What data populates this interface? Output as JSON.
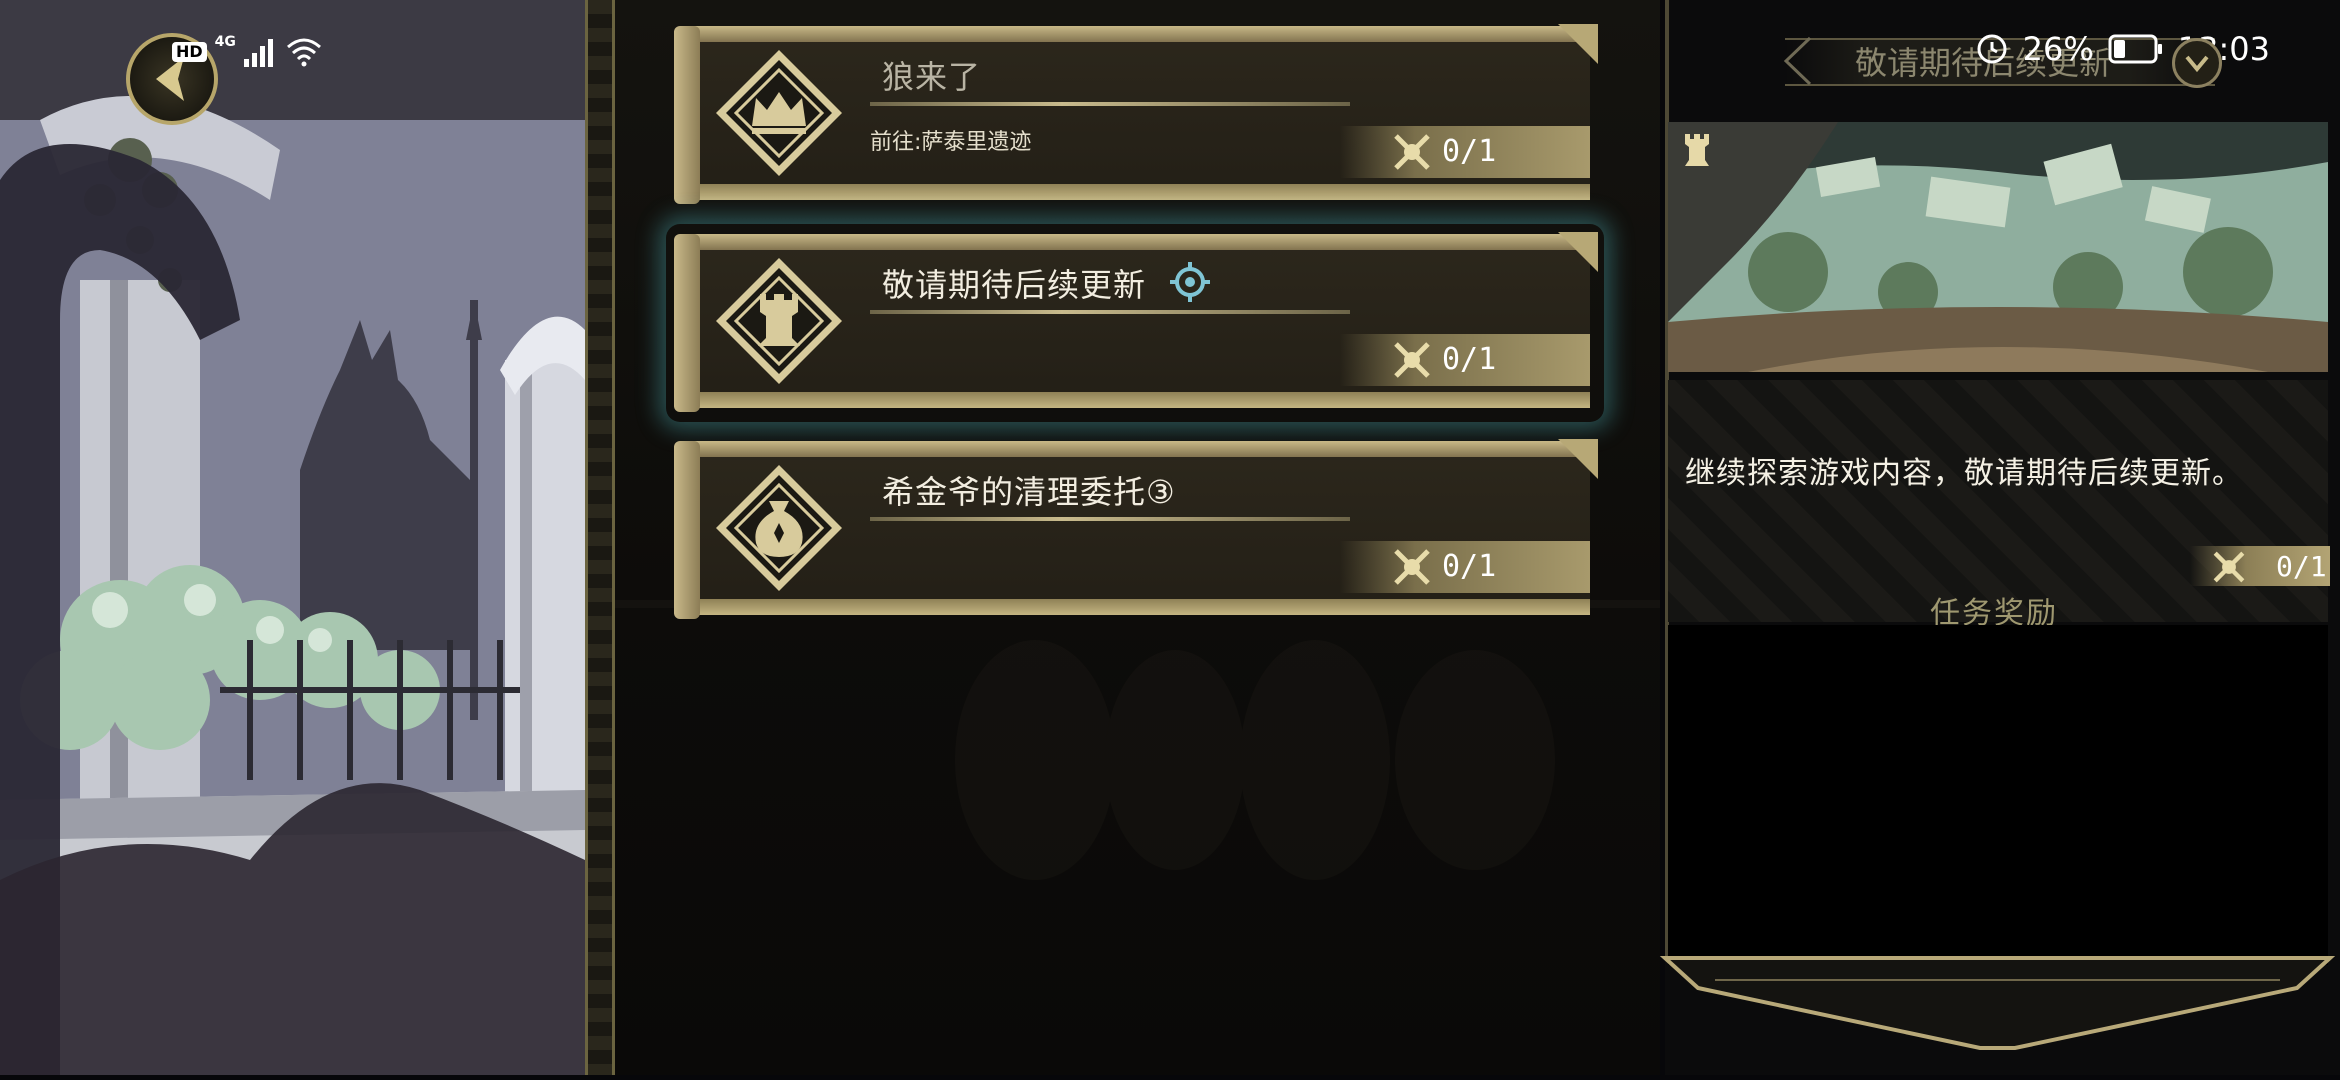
{
  "status_bar": {
    "network": "HD",
    "signal_type": "4G",
    "battery": "26%",
    "time": "13:03"
  },
  "quests": [
    {
      "title": "狼来了",
      "subtitle": "前往:萨泰里遗迹",
      "progress": "0/1",
      "icon": "crown-icon",
      "selected": false
    },
    {
      "title": "敬请期待后续更新",
      "subtitle": "",
      "progress": "0/1",
      "icon": "tower-icon",
      "selected": true
    },
    {
      "title": "希金爷的清理委托③",
      "subtitle": "",
      "progress": "0/1",
      "icon": "money-bag-icon",
      "selected": false
    }
  ],
  "detail": {
    "title": "敬请期待后续更新",
    "description": "继续探索游戏内容，敬请期待后续更新。",
    "progress": "0/1",
    "reward_label": "任务奖励"
  },
  "colors": {
    "gold": "#b7a66a",
    "selected_glow": "#5ac8d2",
    "track_marker": "#7fc4d4"
  }
}
